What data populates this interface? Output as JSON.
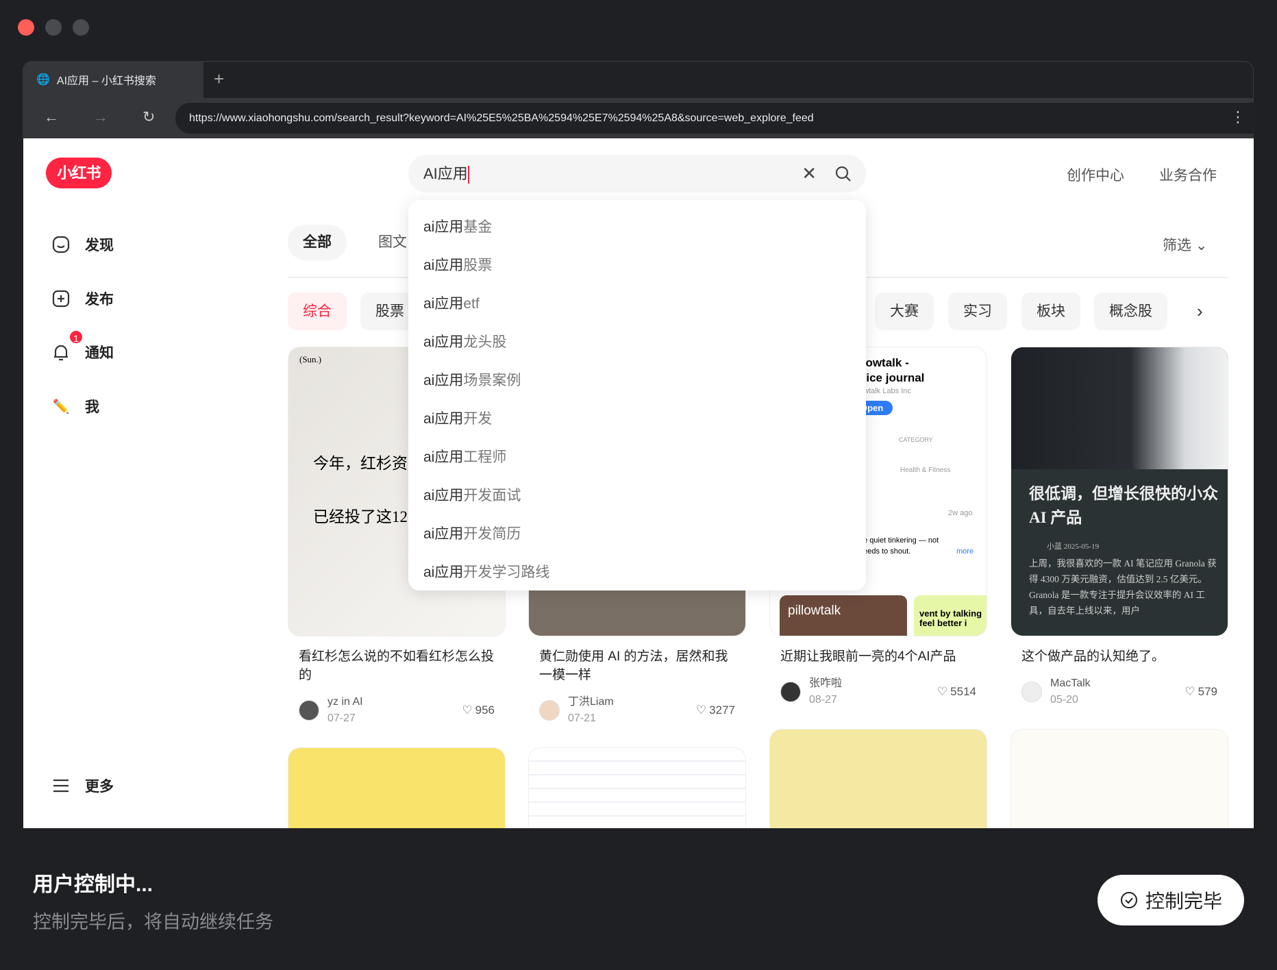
{
  "browser": {
    "tab_title": "AI应用 – 小红书搜索",
    "new_tab": "+",
    "url": "https://www.xiaohongshu.com/search_result?keyword=AI%25E5%25BA%2594%25E7%2594%25A8&source=web_explore_feed"
  },
  "header": {
    "logo": "小红书",
    "search_value": "AI应用",
    "nav": [
      "创作中心",
      "业务合作"
    ]
  },
  "sidebar": {
    "items": [
      {
        "label": "发现"
      },
      {
        "label": "发布"
      },
      {
        "label": "通知",
        "badge": "1"
      },
      {
        "label": "我"
      }
    ],
    "more": "更多"
  },
  "tabs": {
    "items": [
      "全部",
      "图文"
    ],
    "filter": "筛选"
  },
  "chips": {
    "active": "综合",
    "partial": "股票",
    "items": [
      "大赛",
      "实习",
      "板块",
      "概念股"
    ]
  },
  "suggestions": {
    "prefix": "ai应用",
    "items": [
      "基金",
      "股票",
      "etf",
      "龙头股",
      "场景案例",
      "开发",
      "工程师",
      "开发面试",
      "开发简历",
      "开发学习路线"
    ]
  },
  "cards": [
    {
      "title": "看红杉怎么说的不如看红杉怎么投的",
      "author": "yz in AI",
      "date": "07-27",
      "likes": "956",
      "image_text": [
        "(Sun.)",
        "今年，红杉资",
        "已经投了这12"
      ]
    },
    {
      "title": "黄仁勋使用 AI 的方法，居然和我一模一样",
      "author": "丁洪Liam",
      "date": "07-21",
      "likes": "3277"
    },
    {
      "title": "近期让我眼前一亮的4个AI产品",
      "author": "张咋啦",
      "date": "08-27",
      "likes": "5514",
      "image_text": [
        "llowtalk -",
        "oice journal",
        "owtalk Labs Inc",
        "Open",
        "CATEGORY",
        "Health & Fitness",
        "2w ago",
        "ne quiet tinkering — not",
        "needs to shout.",
        "more",
        "pillowtalk",
        "vent by talking",
        "feel better i"
      ]
    },
    {
      "title": "这个做产品的认知绝了。",
      "author": "MacTalk",
      "date": "05-20",
      "likes": "579",
      "image_text": [
        "很低调，但增长很快的小众 AI 产品",
        "小蓝  2025-05-19",
        "上周，我很喜欢的一款 AI 笔记应用 Granola 获得 4300 万美元融资，估值达到 2.5 亿美元。Granola 是一款专注于提升会议效率的 AI 工具，自去年上线以来，用户"
      ]
    }
  ],
  "status": {
    "title": "用户控制中...",
    "subtitle": "控制完毕后，将自动继续任务",
    "done_button": "控制完毕"
  },
  "colors": {
    "brand": "#ff2442",
    "chrome": "#35363a",
    "window": "#1f2023"
  }
}
